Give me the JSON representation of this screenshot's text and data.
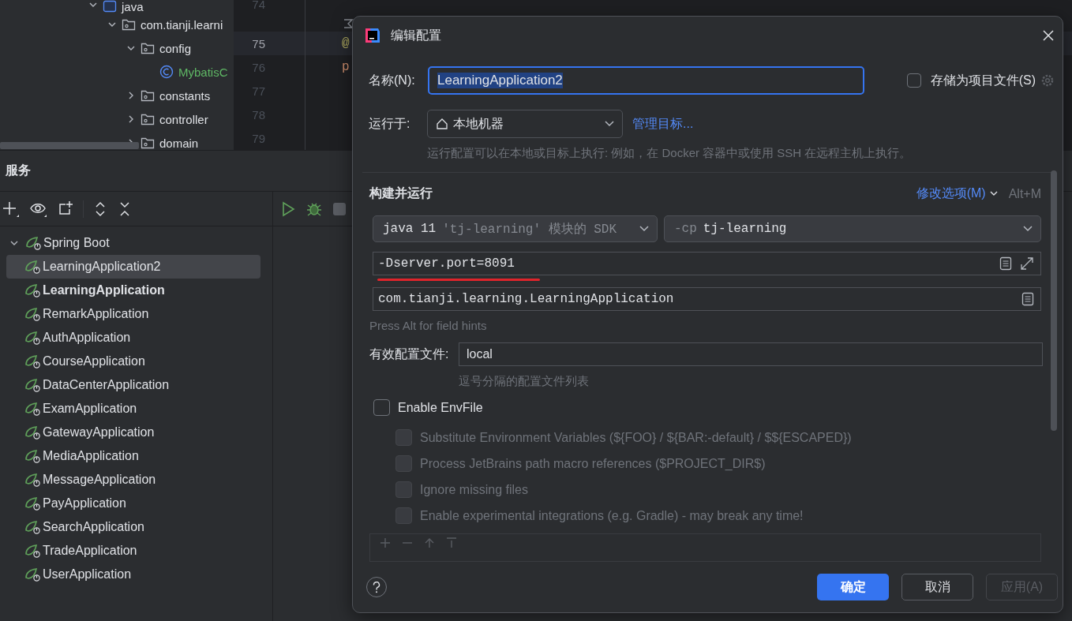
{
  "project_tree": {
    "items": [
      {
        "label": "java",
        "kind": "module",
        "expanded": true,
        "children": [
          {
            "label": "com.tianji.learni",
            "kind": "package",
            "expanded": true,
            "children": [
              {
                "label": "config",
                "kind": "package",
                "expanded": true,
                "children": [
                  {
                    "label": "MybatisC",
                    "kind": "class"
                  }
                ]
              },
              {
                "label": "constants",
                "kind": "package",
                "expanded": false
              },
              {
                "label": "controller",
                "kind": "package",
                "expanded": false
              },
              {
                "label": "domain",
                "kind": "package",
                "expanded": false
              }
            ]
          }
        ]
      }
    ]
  },
  "editor": {
    "lines": [
      {
        "number": "74",
        "current": false
      },
      {
        "kind": "inlay"
      },
      {
        "number": "75",
        "current": true,
        "code": "@"
      },
      {
        "number": "76",
        "current": false,
        "code": "p"
      },
      {
        "number": "77",
        "current": false
      },
      {
        "number": "78",
        "current": false
      },
      {
        "number": "79",
        "current": false
      }
    ]
  },
  "services": {
    "title": "服务",
    "tree": [
      {
        "label": "Spring Boot",
        "expanded": true,
        "selected": false,
        "bold": false,
        "children": [
          {
            "label": "LearningApplication2",
            "selected": true,
            "bold": false
          },
          {
            "label": "LearningApplication",
            "selected": false,
            "bold": true
          },
          {
            "label": "RemarkApplication",
            "selected": false,
            "bold": false
          },
          {
            "label": "AuthApplication",
            "selected": false,
            "bold": false
          },
          {
            "label": "CourseApplication",
            "selected": false,
            "bold": false
          },
          {
            "label": "DataCenterApplication",
            "selected": false,
            "bold": false
          },
          {
            "label": "ExamApplication",
            "selected": false,
            "bold": false
          },
          {
            "label": "GatewayApplication",
            "selected": false,
            "bold": false
          },
          {
            "label": "MediaApplication",
            "selected": false,
            "bold": false
          },
          {
            "label": "MessageApplication",
            "selected": false,
            "bold": false
          },
          {
            "label": "PayApplication",
            "selected": false,
            "bold": false
          },
          {
            "label": "SearchApplication",
            "selected": false,
            "bold": false
          },
          {
            "label": "TradeApplication",
            "selected": false,
            "bold": false
          },
          {
            "label": "UserApplication",
            "selected": false,
            "bold": false
          }
        ]
      }
    ]
  },
  "dialog": {
    "title": "编辑配置",
    "name": {
      "label": "名称(N):",
      "value": "LearningApplication2",
      "focused": true
    },
    "store_as_project_file": {
      "label": "存储为项目文件(S)",
      "checked": false
    },
    "run_on": {
      "label": "运行于:",
      "value": "本地机器",
      "link": "管理目标...",
      "hint": "运行配置可以在本地或目标上执行: 例如，在 Docker 容器中或使用 SSH 在远程主机上执行。"
    },
    "build_and_run": {
      "title": "构建并运行",
      "modify_options": "修改选项(M)",
      "shortcut": "Alt+M",
      "jdk": {
        "value": "java 11",
        "detail": "'tj-learning' 模块的 SDK"
      },
      "classpath": {
        "prefix": "-cp",
        "value": "tj-learning"
      },
      "vm_options": {
        "value": "-Dserver.port=8091",
        "underlined": true
      },
      "main_class": {
        "value": "com.tianji.learning.LearningApplication"
      },
      "field_hint": "Press Alt for field hints"
    },
    "active_profiles": {
      "label": "有效配置文件:",
      "value": "local",
      "hint": "逗号分隔的配置文件列表"
    },
    "envfile": {
      "label": "Enable EnvFile",
      "checked": false,
      "options": [
        {
          "label": "Substitute Environment Variables (${FOO} / ${BAR:-default} / $${ESCAPED})",
          "checked": false,
          "disabled": true
        },
        {
          "label": "Process JetBrains path macro references ($PROJECT_DIR$)",
          "checked": false,
          "disabled": true
        },
        {
          "label": "Ignore missing files",
          "checked": false,
          "disabled": true
        },
        {
          "label": "Enable experimental integrations (e.g. Gradle) - may break any time!",
          "checked": false,
          "disabled": true
        }
      ]
    },
    "buttons": [
      {
        "label": "确定",
        "kind": "primary",
        "disabled": false
      },
      {
        "label": "取消",
        "kind": "secondary",
        "disabled": false
      },
      {
        "label": "应用(A)",
        "kind": "secondary",
        "disabled": true
      }
    ]
  }
}
